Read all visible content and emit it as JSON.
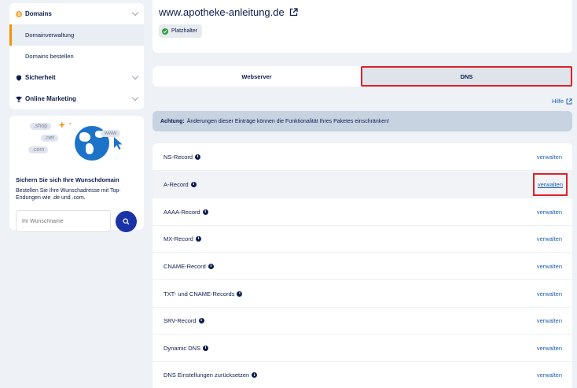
{
  "sidebar": {
    "items": [
      {
        "label": "Domains",
        "icon": "globe-icon"
      },
      {
        "label": "Domainverwaltung"
      },
      {
        "label": "Domains bestellen"
      },
      {
        "label": "Sicherheit",
        "icon": "shield-icon"
      },
      {
        "label": "Online Marketing",
        "icon": "trophy-icon"
      }
    ],
    "promo": {
      "bubbles": [
        ".shop",
        ".net",
        ".com",
        "www"
      ],
      "title": "Sichern Sie sich Ihre Wunschdomain",
      "text": "Bestellen Sie Ihre Wunschadresse mit Top-Endungen wie .de und .com.",
      "placeholder": "Ihr Wunschname"
    }
  },
  "header": {
    "domain": "www.apotheke-anleitung.de",
    "badge": "Platzhalter"
  },
  "tabs": [
    {
      "label": "Webserver",
      "active": false
    },
    {
      "label": "DNS",
      "active": true
    }
  ],
  "help": "Hilfe",
  "warning": {
    "bold": "Achtung:",
    "text": "Änderungen dieser Einträge können die Funktionalität Ihres Paketes einschränken!"
  },
  "records": [
    {
      "name": "NS-Record",
      "action": "verwalten"
    },
    {
      "name": "A-Record",
      "action": "verwalten"
    },
    {
      "name": "AAAA-Record",
      "action": "verwalten"
    },
    {
      "name": "MX-Record",
      "action": "verwalten"
    },
    {
      "name": "CNAME-Record",
      "action": "verwalten"
    },
    {
      "name": "TXT- und CNAME-Records",
      "action": "verwalten"
    },
    {
      "name": "SRV-Record",
      "action": "verwalten"
    },
    {
      "name": "Dynamic DNS",
      "action": "verwalten"
    },
    {
      "name": "DNS Einstellungen zurücksetzen",
      "action": "verwalten"
    }
  ],
  "colors": {
    "accent": "#f39200",
    "primary": "#1b33a6",
    "link": "#1b5fb3",
    "highlight": "#e0202a"
  }
}
